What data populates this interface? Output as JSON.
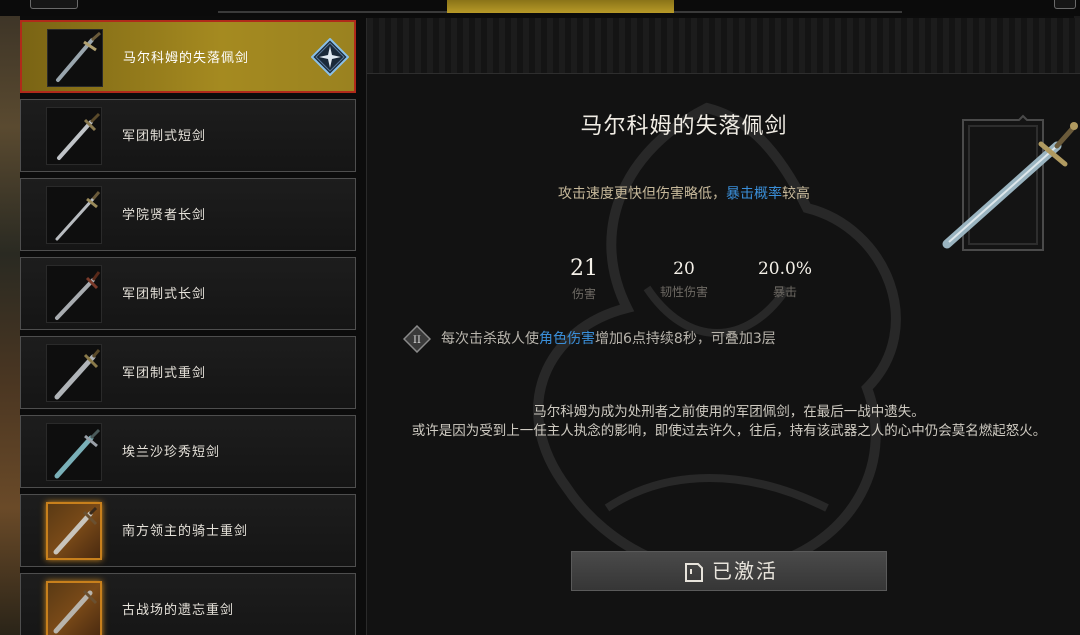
{
  "tabs": [
    {
      "label": ""
    },
    {
      "label": ""
    },
    {
      "label": ""
    }
  ],
  "weapons": [
    {
      "name": "马尔科姆的失落佩剑",
      "selected": true,
      "rarity": "gray"
    },
    {
      "name": "军团制式短剑",
      "selected": false,
      "rarity": "gray"
    },
    {
      "name": "学院贤者长剑",
      "selected": false,
      "rarity": "gray"
    },
    {
      "name": "军团制式长剑",
      "selected": false,
      "rarity": "gray"
    },
    {
      "name": "军团制式重剑",
      "selected": false,
      "rarity": "gray"
    },
    {
      "name": "埃兰沙珍秀短剑",
      "selected": false,
      "rarity": "gray"
    },
    {
      "name": "南方领主的骑士重剑",
      "selected": false,
      "rarity": "orange"
    },
    {
      "name": "古战场的遗忘重剑",
      "selected": false,
      "rarity": "orange"
    }
  ],
  "detail": {
    "title": "马尔科姆的失落佩剑",
    "subtitle_pre": "攻击速度更快但伤害略低，",
    "subtitle_highlight": "暴击概率",
    "subtitle_post": "较高",
    "stats": [
      {
        "value": "21",
        "label": "伤害"
      },
      {
        "value": "20",
        "label": "韧性伤害"
      },
      {
        "value": "20.0%",
        "label": "暴击"
      }
    ],
    "effect_badge": "II",
    "effect_pre": "每次击杀敌人使",
    "effect_highlight": "角色伤害",
    "effect_post": "增加6点持续8秒，可叠加3层",
    "lore_line1": "马尔科姆为成为处刑者之前使用的军团佩剑，在最后一战中遗失。",
    "lore_line2": "或许是因为受到上一任主人执念的影响，即使过去许久，往后，持有该武器之人的心中仍会莫名燃起怒火。",
    "activate_label": "已激活"
  },
  "colors": {
    "selected_bg": "#a58a20",
    "selected_border": "#b02a1a",
    "highlight_blue": "#3a8ed8",
    "orange_rarity": "#c8801c"
  },
  "icons": {
    "selected_badge": "star-diamond-icon",
    "effect": "roman-two-diamond-icon",
    "activate": "document-icon"
  }
}
